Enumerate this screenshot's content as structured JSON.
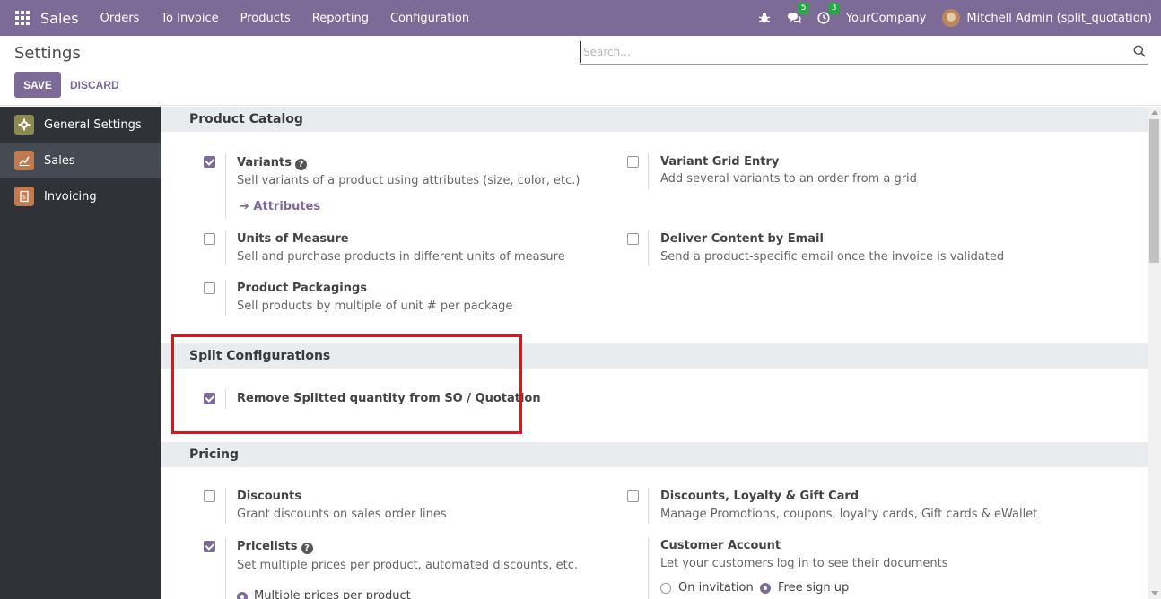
{
  "navbar": {
    "app_name": "Sales",
    "menu": [
      "Orders",
      "To Invoice",
      "Products",
      "Reporting",
      "Configuration"
    ],
    "messages_count": "5",
    "activities_count": "3",
    "company": "YourCompany",
    "user": "Mitchell Admin (split_quotation)",
    "color": "#7c6a97"
  },
  "control_panel": {
    "title": "Settings",
    "save_label": "SAVE",
    "discard_label": "DISCARD",
    "search_placeholder": "Search..."
  },
  "sidebar": {
    "items": [
      {
        "label": "General Settings",
        "icon": "gear-icon",
        "color": "#8c8a4f"
      },
      {
        "label": "Sales",
        "icon": "chart-icon",
        "color": "#c07a4e"
      },
      {
        "label": "Invoicing",
        "icon": "invoice-icon",
        "color": "#c07a4e"
      }
    ]
  },
  "sections": {
    "product_catalog": "Product Catalog",
    "split": "Split Configurations",
    "pricing": "Pricing"
  },
  "settings": {
    "variants": {
      "title": "Variants",
      "desc": "Sell variants of a product using attributes (size, color, etc.)",
      "checked": true,
      "link": "Attributes"
    },
    "variant_grid": {
      "title": "Variant Grid Entry",
      "desc": "Add several variants to an order from a grid",
      "checked": false
    },
    "uom": {
      "title": "Units of Measure",
      "desc": "Sell and purchase products in different units of measure",
      "checked": false
    },
    "deliver_email": {
      "title": "Deliver Content by Email",
      "desc": "Send a product-specific email once the invoice is validated",
      "checked": false
    },
    "packagings": {
      "title": "Product Packagings",
      "desc": "Sell products by multiple of unit # per package",
      "checked": false
    },
    "remove_split": {
      "title": "Remove Splitted quantity from SO / Quotation",
      "checked": true
    },
    "discounts": {
      "title": "Discounts",
      "desc": "Grant discounts on sales order lines",
      "checked": false
    },
    "loyalty": {
      "title": "Discounts, Loyalty & Gift Card",
      "desc": "Manage Promotions, coupons, loyalty cards, Gift cards & eWallet",
      "checked": false
    },
    "pricelists": {
      "title": "Pricelists",
      "desc": "Set multiple prices per product, automated discounts, etc.",
      "checked": true,
      "option": "Multiple prices per product"
    },
    "customer_account": {
      "title": "Customer Account",
      "desc": "Let your customers log in to see their documents",
      "options": [
        "On invitation",
        "Free sign up"
      ],
      "selected": "Free sign up"
    }
  }
}
